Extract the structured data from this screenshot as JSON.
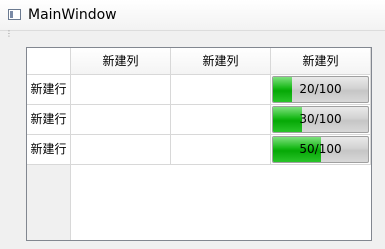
{
  "window": {
    "title": "MainWindow",
    "toolbar_grip": "⋮"
  },
  "table": {
    "column_headers": [
      "新建列",
      "新建列",
      "新建列"
    ],
    "row_headers": [
      "新建行",
      "新建行",
      "新建行"
    ],
    "rows": [
      {
        "col1": "",
        "col2": "",
        "progress": {
          "value": 20,
          "max": 100,
          "text": "20/100"
        }
      },
      {
        "col1": "",
        "col2": "",
        "progress": {
          "value": 30,
          "max": 100,
          "text": "30/100"
        }
      },
      {
        "col1": "",
        "col2": "",
        "progress": {
          "value": 50,
          "max": 100,
          "text": "50/100"
        }
      }
    ]
  },
  "colors": {
    "progress_fill": "#16b816",
    "progress_track": "#d2d2d2",
    "grid_line": "#d8d8d8"
  }
}
